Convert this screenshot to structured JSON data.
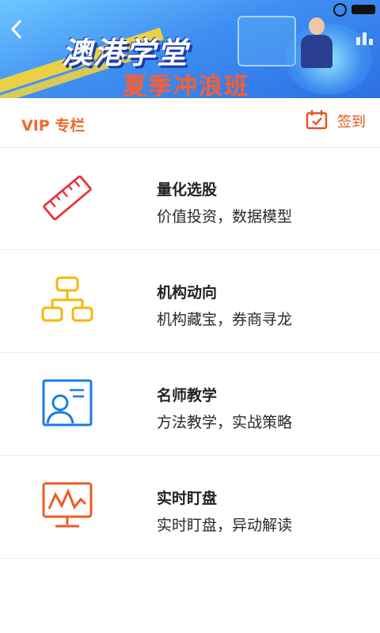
{
  "banner": {
    "logo_text": "澳港学堂",
    "subtitle": "夏季冲浪班"
  },
  "header": {
    "title": "VIP 专栏",
    "signin_label": "签到"
  },
  "items": [
    {
      "title": "量化选股",
      "desc": "价值投资，数据模型",
      "icon": "ruler-icon",
      "color": "#e8333f"
    },
    {
      "title": "机构动向",
      "desc": "机构藏宝，券商寻龙",
      "icon": "org-chart-icon",
      "color": "#f5b800"
    },
    {
      "title": "名师教学",
      "desc": "方法教学，实战策略",
      "icon": "teacher-icon",
      "color": "#1a7de6"
    },
    {
      "title": "实时盯盘",
      "desc": "实时盯盘，异动解读",
      "icon": "monitor-chart-icon",
      "color": "#f05a22"
    }
  ]
}
